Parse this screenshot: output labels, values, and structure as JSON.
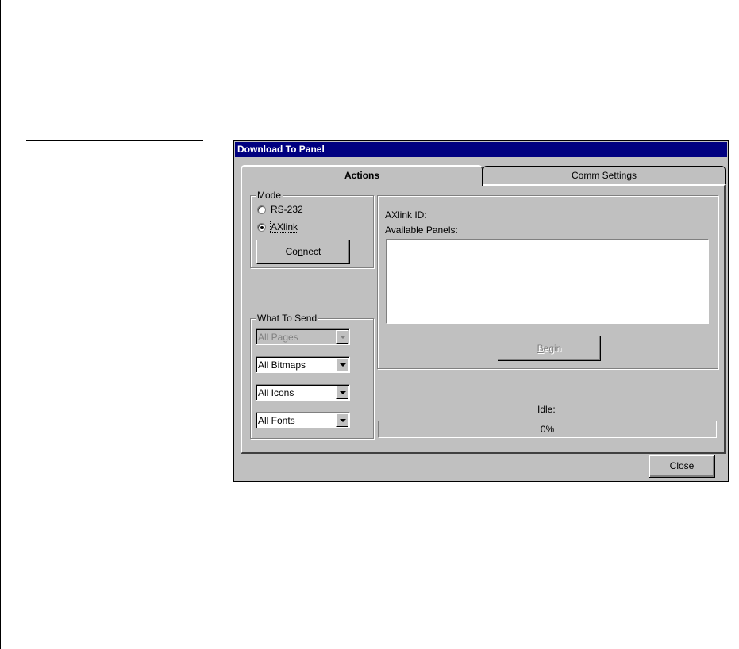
{
  "window": {
    "title": "Download To Panel"
  },
  "tabs": [
    {
      "label": "Actions",
      "selected": true
    },
    {
      "label": "Comm Settings",
      "selected": false
    }
  ],
  "mode": {
    "group_label": "Mode",
    "options": [
      {
        "label": "RS-232",
        "checked": false
      },
      {
        "label": "AXlink",
        "checked": true
      }
    ],
    "connect_button": {
      "label_pre": "Co",
      "label_accel": "n",
      "label_post": "nect"
    }
  },
  "what_to_send": {
    "group_label": "What To Send",
    "selects": [
      {
        "value": "All Pages",
        "disabled": true
      },
      {
        "value": "All Bitmaps",
        "disabled": false
      },
      {
        "value": "All Icons",
        "disabled": false
      },
      {
        "value": "All Fonts",
        "disabled": false
      }
    ]
  },
  "panels": {
    "axlink_id_label": "AXlink ID:",
    "available_panels_label": "Available Panels:",
    "items": [],
    "begin_button": {
      "label_accel": "B",
      "label_post": "egin",
      "disabled": true
    }
  },
  "status": {
    "text": "Idle:",
    "progress_label": "0%",
    "progress_fraction": 0
  },
  "close_button": {
    "label_accel": "C",
    "label_post": "lose"
  }
}
